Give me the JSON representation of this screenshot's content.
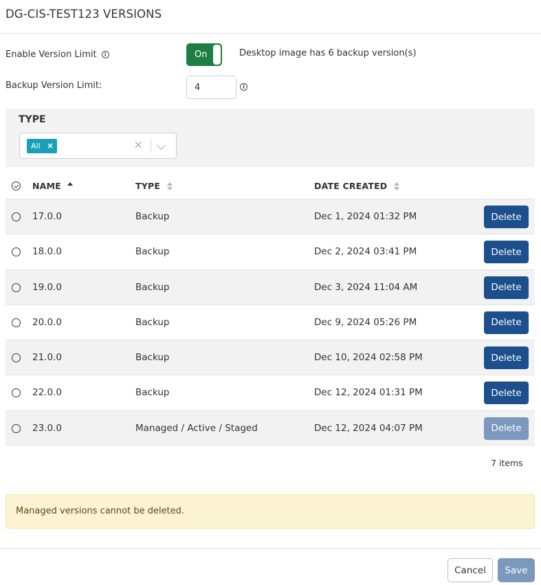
{
  "dialog": {
    "title": "DG-CIS-TEST123 VERSIONS"
  },
  "settings": {
    "enable_label": "Enable Version Limit",
    "toggle_state": "On",
    "backup_count_text": "Desktop image has 6 backup version(s)",
    "limit_label": "Backup Version Limit:",
    "limit_value": "4"
  },
  "filter": {
    "title": "TYPE",
    "chip_label": "All",
    "chip_remove": "×",
    "clear": "×"
  },
  "table": {
    "headers": {
      "name": "NAME",
      "type": "TYPE",
      "date": "DATE CREATED"
    },
    "rows": [
      {
        "name": "17.0.0",
        "type": "Backup",
        "date": "Dec 1, 2024 01:32 PM",
        "action": "Delete"
      },
      {
        "name": "18.0.0",
        "type": "Backup",
        "date": "Dec 2, 2024 03:41 PM",
        "action": "Delete"
      },
      {
        "name": "19.0.0",
        "type": "Backup",
        "date": "Dec 3, 2024 11:04 AM",
        "action": "Delete"
      },
      {
        "name": "20.0.0",
        "type": "Backup",
        "date": "Dec 9, 2024 05:26 PM",
        "action": "Delete"
      },
      {
        "name": "21.0.0",
        "type": "Backup",
        "date": "Dec 10, 2024 02:58 PM",
        "action": "Delete"
      },
      {
        "name": "22.0.0",
        "type": "Backup",
        "date": "Dec 12, 2024 01:31 PM",
        "action": "Delete"
      },
      {
        "name": "23.0.0",
        "type": "Managed / Active / Staged",
        "date": "Dec 12, 2024 04:07 PM",
        "action": "Delete"
      }
    ],
    "items_count": "7 items"
  },
  "warning": {
    "text": "Managed versions cannot be deleted."
  },
  "footer": {
    "cancel_label": "Cancel",
    "save_label": "Save"
  },
  "colors": {
    "toggle_on": "#1e7e45",
    "primary_button": "#1c4f8c",
    "disabled_button": "#7b98bd",
    "chip": "#1a9fb8",
    "warning_bg": "#fdf4d3"
  }
}
